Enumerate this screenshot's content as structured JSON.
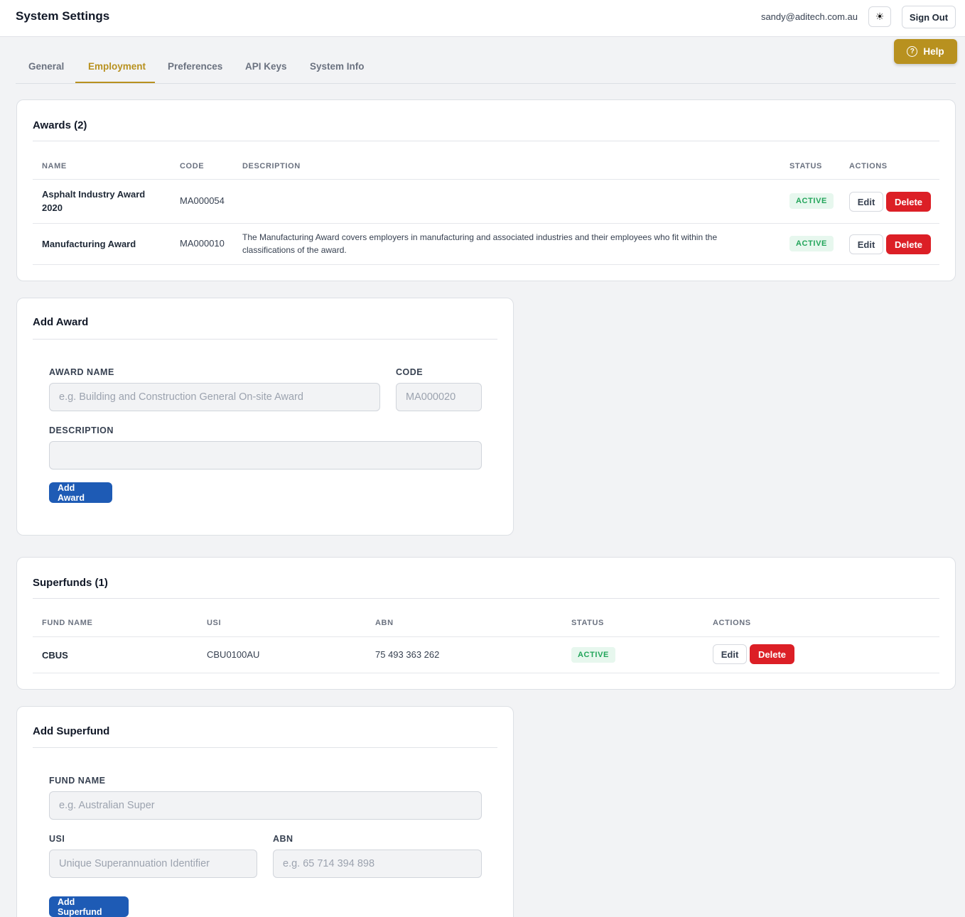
{
  "header": {
    "title": "System Settings",
    "user_email": "sandy@aditech.com.au",
    "theme_icon": "☀",
    "sign_out_label": "Sign Out"
  },
  "help": {
    "label": "Help",
    "icon_glyph": "?"
  },
  "tabs": [
    {
      "label": "General"
    },
    {
      "label": "Employment",
      "active": true
    },
    {
      "label": "Preferences"
    },
    {
      "label": "API Keys"
    },
    {
      "label": "System Info"
    }
  ],
  "awards": {
    "title": "Awards (2)",
    "columns": [
      "NAME",
      "CODE",
      "DESCRIPTION",
      "STATUS",
      "ACTIONS"
    ],
    "rows": [
      {
        "name": "Asphalt Industry Award 2020",
        "code": "MA000054",
        "description": "",
        "status": "ACTIVE",
        "edit_label": "Edit",
        "delete_label": "Delete"
      },
      {
        "name": "Manufacturing Award",
        "code": "MA000010",
        "description": "The Manufacturing Award covers employers in manufacturing and associated industries and their employees who fit within the classifications of the award.",
        "status": "ACTIVE",
        "edit_label": "Edit",
        "delete_label": "Delete"
      }
    ]
  },
  "add_award": {
    "title": "Add Award",
    "award_name_label": "AWARD NAME",
    "award_name_placeholder": "e.g. Building and Construction General On-site Award",
    "code_label": "CODE",
    "code_placeholder": "MA000020",
    "description_label": "DESCRIPTION",
    "description_placeholder": "",
    "submit_label": "Add Award"
  },
  "superfunds": {
    "title": "Superfunds (1)",
    "columns": [
      "FUND NAME",
      "USI",
      "ABN",
      "STATUS",
      "ACTIONS"
    ],
    "rows": [
      {
        "fund_name": "CBUS",
        "usi": "CBU0100AU",
        "abn": "75 493 363 262",
        "status": "ACTIVE",
        "edit_label": "Edit",
        "delete_label": "Delete"
      }
    ]
  },
  "add_superfund": {
    "title": "Add Superfund",
    "fund_name_label": "FUND NAME",
    "fund_name_placeholder": "e.g. Australian Super",
    "usi_label": "USI",
    "usi_placeholder": "Unique Superannuation Identifier",
    "abn_label": "ABN",
    "abn_placeholder": "e.g. 65 714 394 898",
    "submit_label": "Add Superfund"
  },
  "colors": {
    "accent_gold": "#b8911f",
    "primary_blue": "#1e5bb5",
    "danger_red": "#dc1f26",
    "success_green": "#22a55a"
  }
}
